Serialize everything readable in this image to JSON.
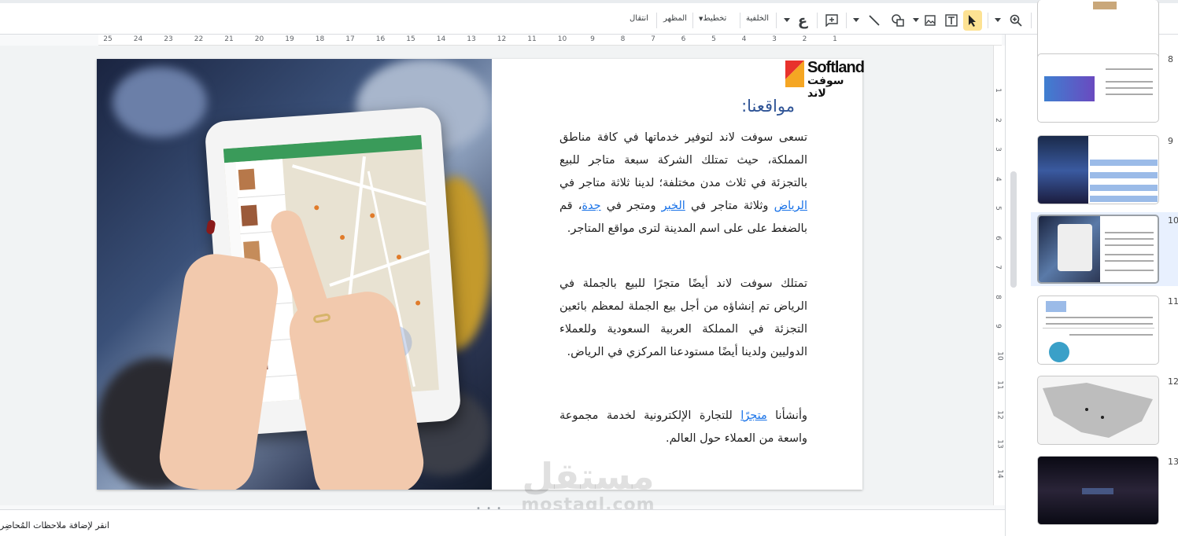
{
  "toolbar": {
    "transition_label": "انتقال",
    "theme_label": "المظهر",
    "layout_label": "تخطيط",
    "background_label": "الخلفية",
    "arabic_glyph": "ع",
    "icons": [
      "new-slide-icon",
      "undo-icon",
      "redo-icon",
      "print-icon",
      "paint-format-icon",
      "zoom-icon",
      "select-icon",
      "textbox-icon",
      "image-icon",
      "shape-icon",
      "line-icon",
      "comment-icon",
      "input-tools-icon"
    ]
  },
  "ruler_top": [
    "25",
    "24",
    "23",
    "22",
    "21",
    "20",
    "19",
    "18",
    "17",
    "16",
    "15",
    "14",
    "13",
    "12",
    "11",
    "10",
    "9",
    "8",
    "7",
    "6",
    "5",
    "4",
    "3",
    "2",
    "1"
  ],
  "ruler_left": [
    "1",
    "2",
    "3",
    "4",
    "5",
    "6",
    "7",
    "8",
    "9",
    "10",
    "11",
    "12",
    "13",
    "14"
  ],
  "slide": {
    "logo_en": "Softland",
    "logo_ar": "سوفت لاند",
    "heading": "مواقعنا:",
    "p1_a": "تسعى سوفت لاند لتوفير خدماتها في كافة مناطق المملكة، حيث تمتلك الشركة سبعة متاجر للبيع بالتجزئة في ثلاث مدن مختلفة؛ لدينا ثلاثة متاجر في ",
    "link_riyadh": "الرياض",
    "p1_b": " وثلاثة متاجر في ",
    "link_khobar": "الخبر",
    "p1_c": " ومتجر في ",
    "link_jeddah": "جدة",
    "p1_d": "، قم بالضغط على على اسم المدينة لترى مواقع المتاجر.",
    "p2": "تمتلك سوفت لاند أيضًا متجرًا للبيع بالجملة في الرياض تم إنشاؤه من أجل بيع الجملة لمعظم بائعين التجزئة في المملكة العربية السعودية وللعملاء الدوليين ولدينا أيضًا مستودعنا المركزي في الرياض.",
    "p3_a": "وأنشأنا ",
    "link_store": "متجرًا",
    "p3_b": " للتجارة الإلكترونية لخدمة مجموعة واسعة من العملاء حول العالم."
  },
  "watermark": {
    "ar": "مستقل",
    "en": "mostaql.com"
  },
  "notes_placeholder": "انقر لإضافة ملاحظات المُحاضِر",
  "filmstrip": {
    "selected": "10",
    "slides": [
      {
        "num": "8"
      },
      {
        "num": "9"
      },
      {
        "num": "10"
      },
      {
        "num": "11"
      },
      {
        "num": "12"
      },
      {
        "num": "13"
      }
    ]
  },
  "colors": {
    "heading": "#2f5496",
    "link": "#1a73e8",
    "logo_red": "#e8322c",
    "logo_yellow": "#f5a623"
  }
}
